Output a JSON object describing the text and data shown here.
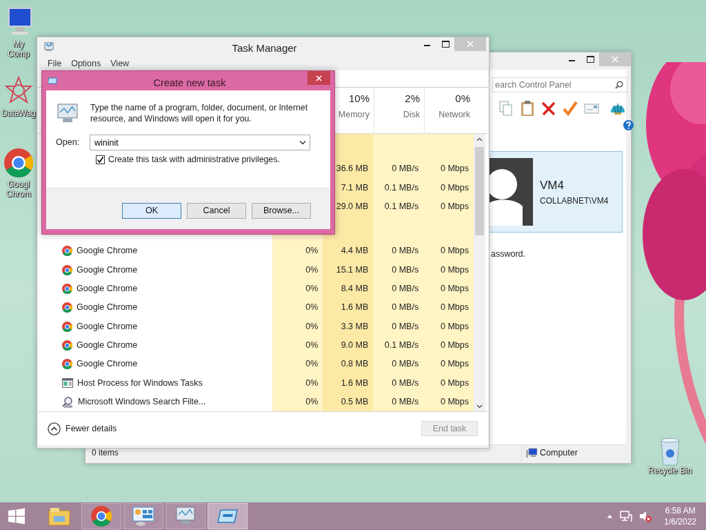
{
  "desktop_icons": [
    {
      "kind": "computer",
      "label": "My Comp"
    },
    {
      "kind": "star",
      "label": "DataWag"
    },
    {
      "kind": "browser",
      "label": "Googl Chrom"
    }
  ],
  "recycle_bin": {
    "label": "Recycle Bin"
  },
  "control_panel": {
    "search": {
      "placeholder": "earch Control Panel"
    },
    "user": {
      "name": "VM4",
      "account": "COLLABNET\\VM4"
    },
    "text": "assword.",
    "status_bar": {
      "items": "0 items",
      "location": "Computer"
    }
  },
  "task_manager": {
    "title": "Task Manager",
    "menu": [
      "File",
      "Options",
      "View"
    ],
    "columns": [
      {
        "percent": "10%",
        "label": "Memory"
      },
      {
        "percent": "2%",
        "label": "Disk"
      },
      {
        "percent": "0%",
        "label": "Network"
      }
    ],
    "rows": [
      {
        "kind": "group"
      },
      {
        "kind": "covered",
        "memory": "36.6 MB",
        "disk": "0 MB/s",
        "network": "0 Mbps"
      },
      {
        "kind": "covered",
        "memory": "7.1 MB",
        "disk": "0.1 MB/s",
        "network": "0 Mbps"
      },
      {
        "kind": "covered",
        "memory": "29.0 MB",
        "disk": "0.1 MB/s",
        "network": "0 Mbps"
      },
      {
        "kind": "group"
      },
      {
        "kind": "chrome",
        "name": "Google Chrome",
        "cpu": "0%",
        "memory": "4.4 MB",
        "disk": "0 MB/s",
        "network": "0 Mbps"
      },
      {
        "kind": "chrome",
        "name": "Google Chrome",
        "cpu": "0%",
        "memory": "15.1 MB",
        "disk": "0 MB/s",
        "network": "0 Mbps"
      },
      {
        "kind": "chrome",
        "name": "Google Chrome",
        "cpu": "0%",
        "memory": "8.4 MB",
        "disk": "0 MB/s",
        "network": "0 Mbps"
      },
      {
        "kind": "chrome",
        "name": "Google Chrome",
        "cpu": "0%",
        "memory": "1.6 MB",
        "disk": "0 MB/s",
        "network": "0 Mbps"
      },
      {
        "kind": "chrome",
        "name": "Google Chrome",
        "cpu": "0%",
        "memory": "3.3 MB",
        "disk": "0 MB/s",
        "network": "0 Mbps"
      },
      {
        "kind": "chrome",
        "name": "Google Chrome",
        "cpu": "0%",
        "memory": "9.0 MB",
        "disk": "0.1 MB/s",
        "network": "0 Mbps"
      },
      {
        "kind": "chrome",
        "name": "Google Chrome",
        "cpu": "0%",
        "memory": "0.8 MB",
        "disk": "0 MB/s",
        "network": "0 Mbps"
      },
      {
        "kind": "host",
        "name": "Host Process for Windows Tasks",
        "cpu": "0%",
        "memory": "1.6 MB",
        "disk": "0 MB/s",
        "network": "0 Mbps"
      },
      {
        "kind": "search",
        "name": "Microsoft Windows Search Filte...",
        "cpu": "0%",
        "memory": "0.5 MB",
        "disk": "0 MB/s",
        "network": "0 Mbps"
      }
    ],
    "footer": {
      "toggle": "Fewer details",
      "end_task": {
        "label": "End task",
        "disabled": true
      }
    }
  },
  "dialog": {
    "title": "Create new task",
    "message": "Type the name of a program, folder, document, or Internet resource, and Windows will open it for you.",
    "open_label": "Open:",
    "value": "wininit",
    "checkbox": {
      "label": "Create this task with administrative privileges.",
      "checked": true
    },
    "buttons": [
      {
        "label": "OK",
        "selected": true
      },
      {
        "label": "Cancel",
        "selected": false
      },
      {
        "label": "Browse...",
        "selected": false
      }
    ]
  },
  "taskbar": {
    "items": [
      {
        "kind": "explorer",
        "running": false,
        "selected": false
      },
      {
        "kind": "browser",
        "running": true,
        "selected": false
      },
      {
        "kind": "control-panel",
        "running": true,
        "selected": false
      },
      {
        "kind": "task-manager",
        "running": true,
        "selected": false
      },
      {
        "kind": "run",
        "running": true,
        "selected": true
      }
    ],
    "clock": {
      "time": "6:58 AM",
      "date": "1/6/2022"
    }
  }
}
